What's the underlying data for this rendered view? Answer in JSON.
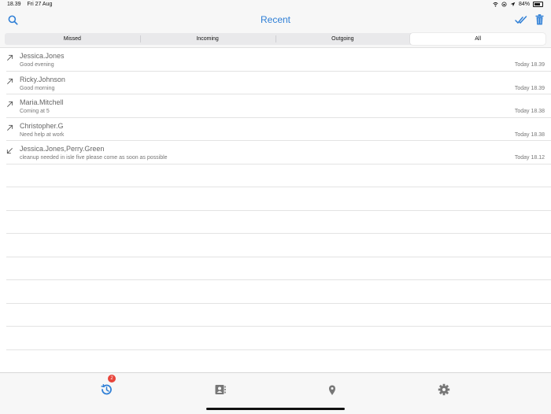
{
  "status_bar": {
    "time": "18.39",
    "date": "Fri 27 Aug",
    "battery": "84%"
  },
  "nav": {
    "title": "Recent",
    "search_icon": "search-icon",
    "mark_read_icon": "double-check-icon",
    "delete_icon": "trash-icon",
    "accent_color": "#2f7fd6"
  },
  "segments": [
    "Missed",
    "Incoming",
    "Outgoing",
    "All"
  ],
  "selected_segment": "All",
  "calls": [
    {
      "direction": "outgoing",
      "name": "Jessica.Jones",
      "message": "Good evening",
      "time": "Today 18.39"
    },
    {
      "direction": "outgoing",
      "name": "Ricky.Johnson",
      "message": "Good morning",
      "time": "Today 18.39"
    },
    {
      "direction": "outgoing",
      "name": "Maria.Mitchell",
      "message": "Coming at 5",
      "time": "Today 18.38"
    },
    {
      "direction": "outgoing",
      "name": "Christopher.G",
      "message": "Need help at work",
      "time": "Today 18.38"
    },
    {
      "direction": "incoming",
      "name": "Jessica.Jones,Perry.Green",
      "message": "cleanup needed in isle five please come as soon as possible",
      "time": "Today 18.12"
    }
  ],
  "tabbar": {
    "recents_badge": "2",
    "tabs": [
      "recents-icon",
      "contacts-icon",
      "location-pin-icon",
      "settings-gear-icon"
    ]
  }
}
